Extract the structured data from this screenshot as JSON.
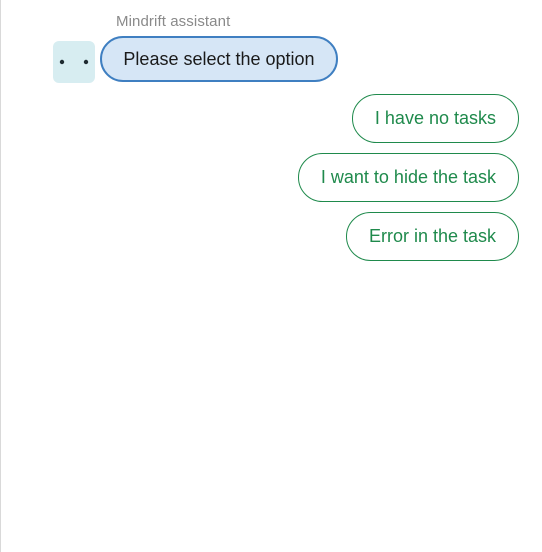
{
  "chat": {
    "sender_name": "Mindrift assistant",
    "avatar_icon": "typing-dots-icon",
    "message": "Please select the option",
    "options": [
      {
        "label": "I have no tasks"
      },
      {
        "label": "I want to hide the task"
      },
      {
        "label": "Error in the task"
      }
    ]
  },
  "colors": {
    "accent_green": "#1f8a4c",
    "bubble_fill": "#d6e6f6",
    "bubble_border": "#3f7fc1",
    "avatar_bg": "#d7edf1"
  }
}
